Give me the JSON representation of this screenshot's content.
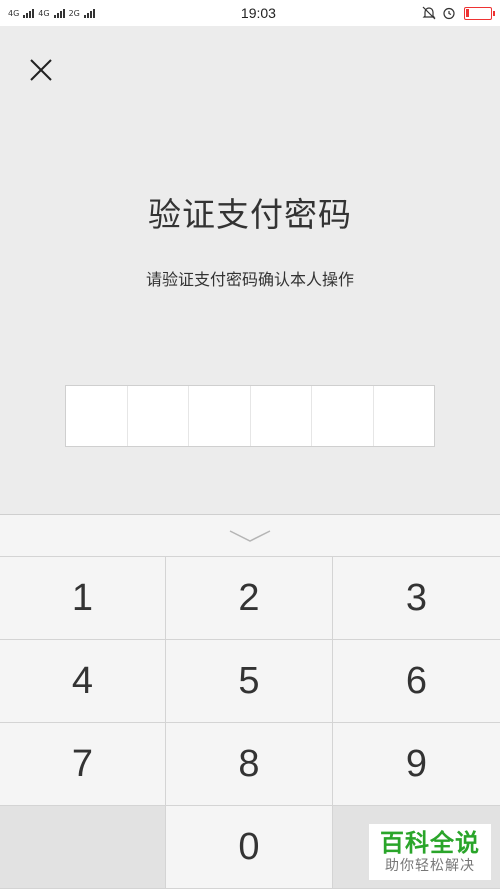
{
  "status_bar": {
    "network_1": "4G",
    "network_2": "4G",
    "network_3": "2G",
    "time": "19:03"
  },
  "title": "验证支付密码",
  "subtitle": "请验证支付密码确认本人操作",
  "pin": {
    "length": 6,
    "entered": 0
  },
  "keypad": {
    "keys": [
      "1",
      "2",
      "3",
      "4",
      "5",
      "6",
      "7",
      "8",
      "9",
      "",
      "0",
      ""
    ]
  },
  "watermark": {
    "main": "百科全说",
    "sub": "助你轻松解决"
  }
}
